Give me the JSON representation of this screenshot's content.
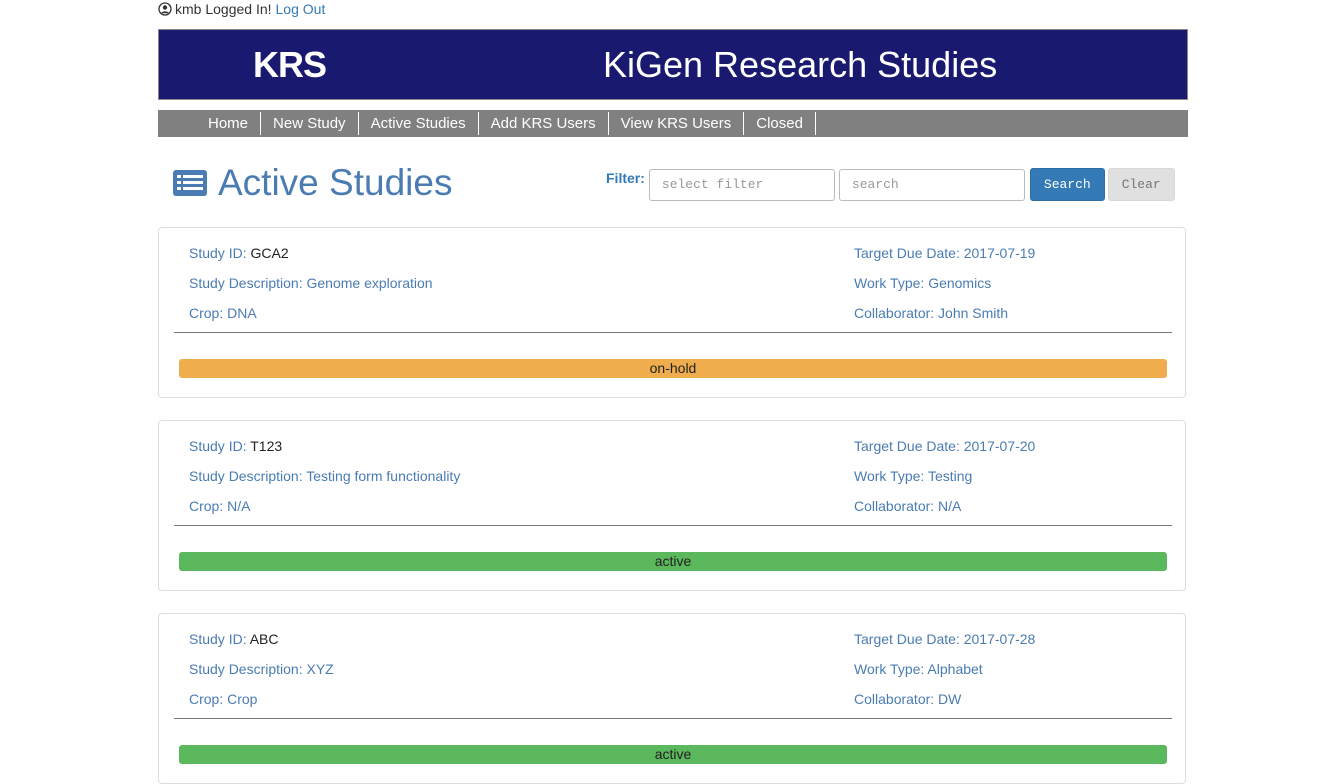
{
  "login": {
    "username_text": "kmb Logged In!",
    "logout_label": "Log Out"
  },
  "banner": {
    "abbr": "KRS",
    "title": "KiGen Research Studies",
    "bg_color": "#191970"
  },
  "nav": {
    "items": [
      "Home",
      "New Study",
      "Active Studies",
      "Add KRS Users",
      "View KRS Users",
      "Closed"
    ]
  },
  "page": {
    "title": "Active Studies",
    "icon": "list-icon"
  },
  "filter": {
    "label": "Filter:",
    "select_placeholder": "select filter",
    "search_placeholder": "search",
    "search_button": "Search",
    "clear_button": "Clear"
  },
  "labels": {
    "study_id": "Study ID:",
    "description": "Study Description:",
    "crop": "Crop:",
    "due_date": "Target Due Date:",
    "work_type": "Work Type:",
    "collaborator": "Collaborator:"
  },
  "studies": [
    {
      "id": "GCA2",
      "description": "Genome exploration",
      "crop": "DNA",
      "due_date": "2017-07-19",
      "work_type": "Genomics",
      "collaborator": "John Smith",
      "status": "on-hold",
      "status_color": "#f0ad4e"
    },
    {
      "id": "T123",
      "description": "Testing form functionality",
      "crop": "N/A",
      "due_date": "2017-07-20",
      "work_type": "Testing",
      "collaborator": "N/A",
      "status": "active",
      "status_color": "#5cb85c"
    },
    {
      "id": "ABC",
      "description": "XYZ",
      "crop": "Crop",
      "due_date": "2017-07-28",
      "work_type": "Alphabet",
      "collaborator": "DW",
      "status": "active",
      "status_color": "#5cb85c"
    }
  ]
}
